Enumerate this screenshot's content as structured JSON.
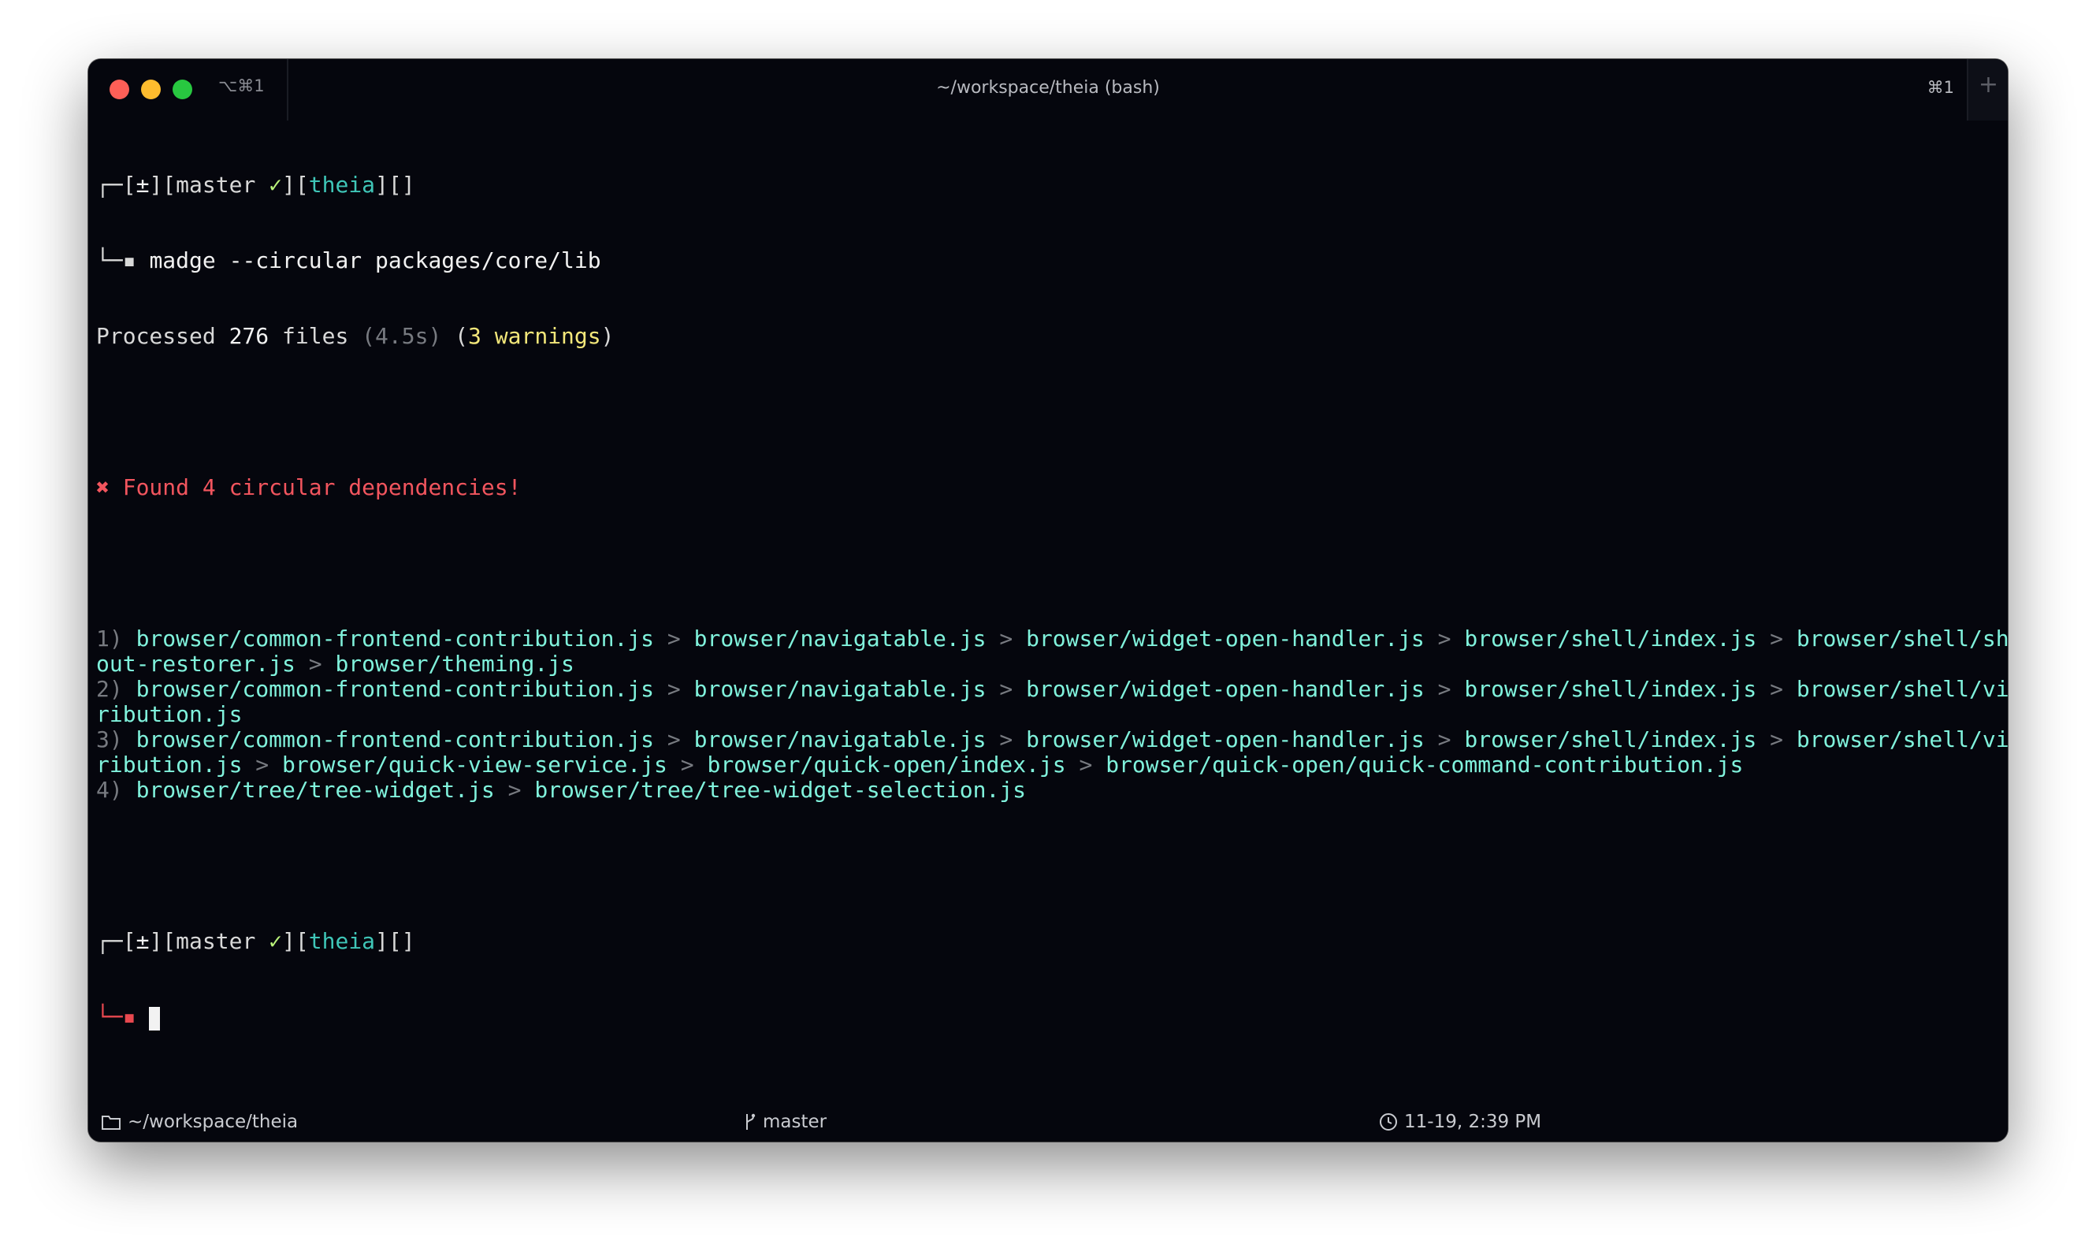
{
  "titlebar": {
    "tab_shortcut": "⌥⌘1",
    "title": "~/workspace/theia (bash)",
    "cmd_hint": "⌘1",
    "new_tab": "+"
  },
  "prompt": {
    "tl": "┌─",
    "bl": "└─",
    "br_open": "[",
    "br_close": "]",
    "dirty": "±",
    "branch": "master",
    "check": "✓",
    "repo": "theia",
    "empty_brackets": "[]",
    "square": "▪"
  },
  "command": "madge --circular packages/core/lib",
  "processed": {
    "prefix": "Processed ",
    "count": "276",
    "files": " files ",
    "time": "(4.5s)",
    "open": " (",
    "warnings": "3 warnings",
    "close": ")"
  },
  "found": {
    "icon": "✖",
    "text": " Found 4 circular dependencies!"
  },
  "sep": " > ",
  "deps": [
    {
      "num": "1) ",
      "line1": [
        "browser/common-frontend-contribution.js",
        "browser/navigatable.js",
        "browser/widget-open-handler.js",
        "browser/shell/index.js",
        "browser/shell/shell-lay"
      ],
      "line2": [
        "out-restorer.js",
        "browser/theming.js"
      ]
    },
    {
      "num": "2) ",
      "line1": [
        "browser/common-frontend-contribution.js",
        "browser/navigatable.js",
        "browser/widget-open-handler.js",
        "browser/shell/index.js",
        "browser/shell/view-cont"
      ],
      "line2": [
        "ribution.js"
      ]
    },
    {
      "num": "3) ",
      "line1": [
        "browser/common-frontend-contribution.js",
        "browser/navigatable.js",
        "browser/widget-open-handler.js",
        "browser/shell/index.js",
        "browser/shell/view-cont"
      ],
      "line2": [
        "ribution.js",
        "browser/quick-view-service.js",
        "browser/quick-open/index.js",
        "browser/quick-open/quick-command-contribution.js"
      ]
    },
    {
      "num": "4) ",
      "line1": [
        "browser/tree/tree-widget.js",
        "browser/tree/tree-widget-selection.js"
      ],
      "line2": []
    }
  ],
  "status": {
    "path": "~/workspace/theia",
    "branch": "master",
    "time": "11-19, 2:39 PM"
  },
  "icons": {
    "folder": "folder-icon",
    "branch": "git-branch-icon",
    "clock": "clock-icon"
  }
}
